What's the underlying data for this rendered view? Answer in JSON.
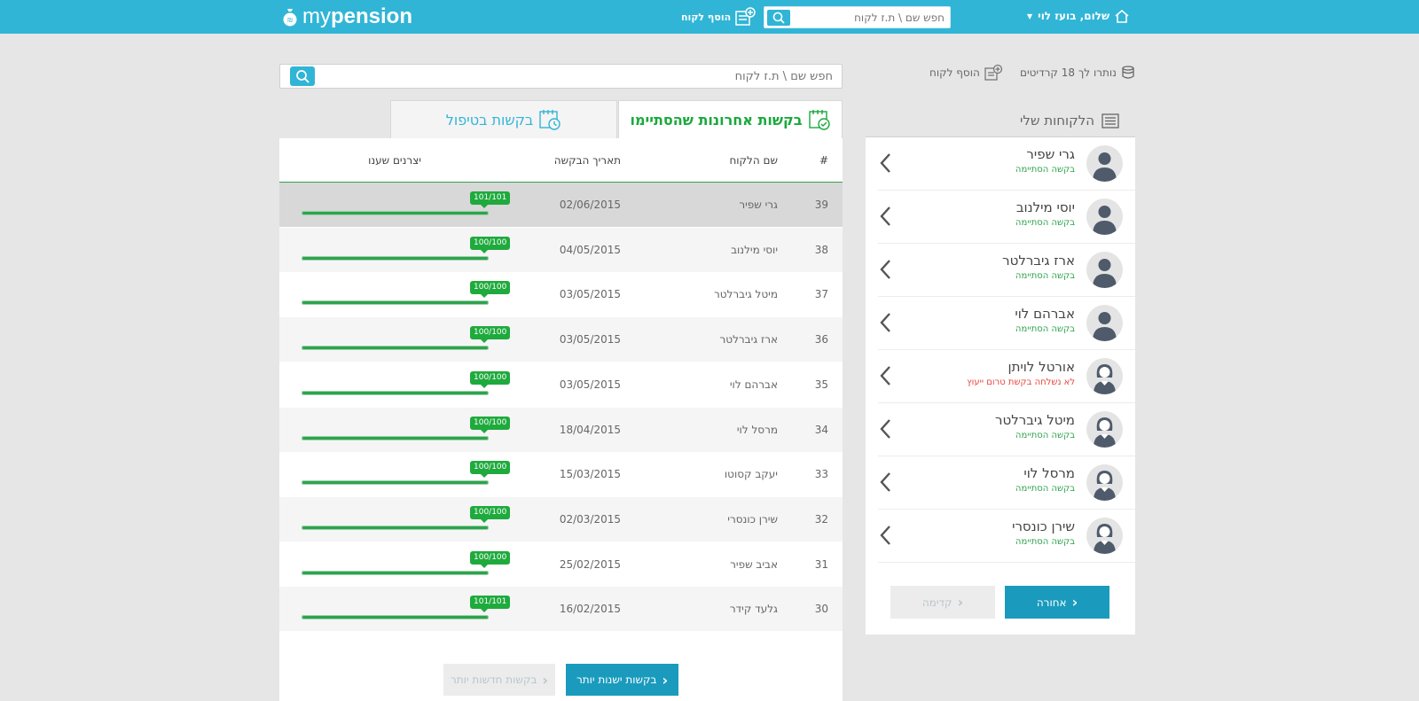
{
  "brand": {
    "logo_prefix": "my",
    "logo_suffix": "pension",
    "accent": "#31b5d6",
    "success": "#2ea34d",
    "warning": "#e8453c"
  },
  "header": {
    "add_client_label": "הוסף לקוח",
    "search_placeholder": "חפש שם \\ ת.ז לקוח",
    "greeting": "שלום, בועז לוי",
    "icons": [
      "add-client-icon",
      "search-icon",
      "home-icon",
      "dropdown-arrow-icon"
    ]
  },
  "main": {
    "search_placeholder": "חפש שם \\ ת.ז לקוח",
    "tabs": [
      {
        "label": "בקשות אחרונות שהסתיימו",
        "active": true,
        "icon": "calendar-check-icon"
      },
      {
        "label": "בקשות בטיפול",
        "active": false,
        "icon": "calendar-clock-icon"
      }
    ],
    "columns": {
      "num": "#",
      "name": "שם הלקוח",
      "date": "תאריך הבקשה",
      "manufacturers": "יצרנים שענו"
    },
    "rows": [
      {
        "num": "39",
        "name": "גרי שפיר",
        "date": "02/06/2015",
        "progress": "101/101",
        "fraction": 1.0
      },
      {
        "num": "38",
        "name": "יוסי מילנוב",
        "date": "04/05/2015",
        "progress": "100/100",
        "fraction": 1.0
      },
      {
        "num": "37",
        "name": "מיטל גיברלטר",
        "date": "03/05/2015",
        "progress": "100/100",
        "fraction": 1.0
      },
      {
        "num": "36",
        "name": "ארז גיברלטר",
        "date": "03/05/2015",
        "progress": "100/100",
        "fraction": 1.0
      },
      {
        "num": "35",
        "name": "אברהם לוי",
        "date": "03/05/2015",
        "progress": "100/100",
        "fraction": 1.0
      },
      {
        "num": "34",
        "name": "מרסל לוי",
        "date": "18/04/2015",
        "progress": "100/100",
        "fraction": 1.0
      },
      {
        "num": "33",
        "name": "יעקב קסוטו",
        "date": "15/03/2015",
        "progress": "100/100",
        "fraction": 1.0
      },
      {
        "num": "32",
        "name": "שירן כונסרי",
        "date": "02/03/2015",
        "progress": "100/100",
        "fraction": 1.0
      },
      {
        "num": "31",
        "name": "אביב שפיר",
        "date": "25/02/2015",
        "progress": "100/100",
        "fraction": 1.0
      },
      {
        "num": "30",
        "name": "גלעד קידר",
        "date": "16/02/2015",
        "progress": "101/101",
        "fraction": 1.0
      }
    ],
    "older_label": "בקשות ישנות יותר",
    "newer_label": "בקשות חדשות יותר"
  },
  "sidebar": {
    "credits_label": "נותרו לך 18 קרדיטים",
    "add_client_label": "הוסף לקוח",
    "title": "הלקוחות שלי",
    "clients": [
      {
        "name": "גרי שפיר",
        "status": "בקשה הסתיימה",
        "gender": "male",
        "warn": false
      },
      {
        "name": "יוסי מילנוב",
        "status": "בקשה הסתיימה",
        "gender": "male",
        "warn": false
      },
      {
        "name": "ארז גיברלטר",
        "status": "בקשה הסתיימה",
        "gender": "male",
        "warn": false
      },
      {
        "name": "אברהם לוי",
        "status": "בקשה הסתיימה",
        "gender": "male",
        "warn": false
      },
      {
        "name": "אורטל לויתן",
        "status": "לא נשלחה בקשת טרום ייעוץ",
        "gender": "female",
        "warn": true
      },
      {
        "name": "מיטל גיברלטר",
        "status": "בקשה הסתיימה",
        "gender": "female",
        "warn": false
      },
      {
        "name": "מרסל לוי",
        "status": "בקשה הסתיימה",
        "gender": "female",
        "warn": false
      },
      {
        "name": "שירן כונסרי",
        "status": "בקשה הסתיימה",
        "gender": "female",
        "warn": false
      }
    ],
    "next_label": "אחורה",
    "prev_label": "קדימה"
  }
}
